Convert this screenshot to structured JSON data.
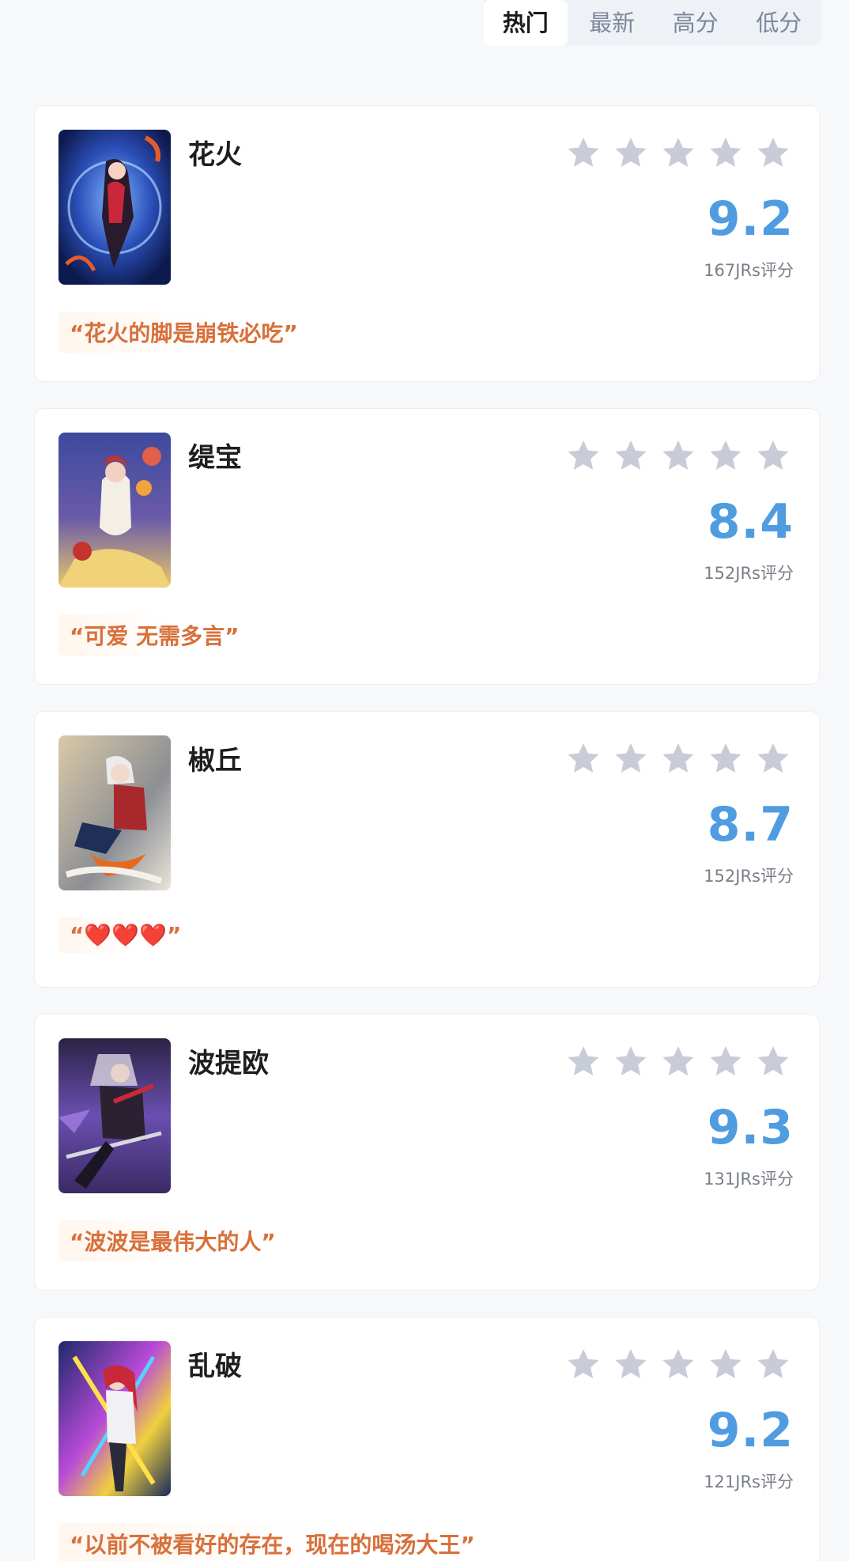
{
  "sort_tabs": [
    {
      "label": "热门",
      "active": true
    },
    {
      "label": "最新",
      "active": false
    },
    {
      "label": "高分",
      "active": false
    },
    {
      "label": "低分",
      "active": false
    }
  ],
  "colors": {
    "score": "#4f9ce0",
    "quote": "#d8703a",
    "star_inactive": "#c8ccd6",
    "active_tab_text": "#1b1b1b",
    "inactive_tab_text": "#7d8899"
  },
  "characters": [
    {
      "name": "花火",
      "rating": "9.2",
      "raters": "167JRs评分",
      "quote": "“花火的脚是崩铁必吃”",
      "stars_filled": 0
    },
    {
      "name": "缇宝",
      "rating": "8.4",
      "raters": "152JRs评分",
      "quote": "“可爱 无需多言”",
      "stars_filled": 0
    },
    {
      "name": "椒丘",
      "rating": "8.7",
      "raters": "152JRs评分",
      "quote": "“❤️❤️❤️”",
      "stars_filled": 0
    },
    {
      "name": "波提欧",
      "rating": "9.3",
      "raters": "131JRs评分",
      "quote": "“波波是最伟大的人”",
      "stars_filled": 0
    },
    {
      "name": "乱破",
      "rating": "9.2",
      "raters": "121JRs评分",
      "quote": "“以前不被看好的存在，现在的喝汤大王”",
      "stars_filled": 0
    }
  ]
}
